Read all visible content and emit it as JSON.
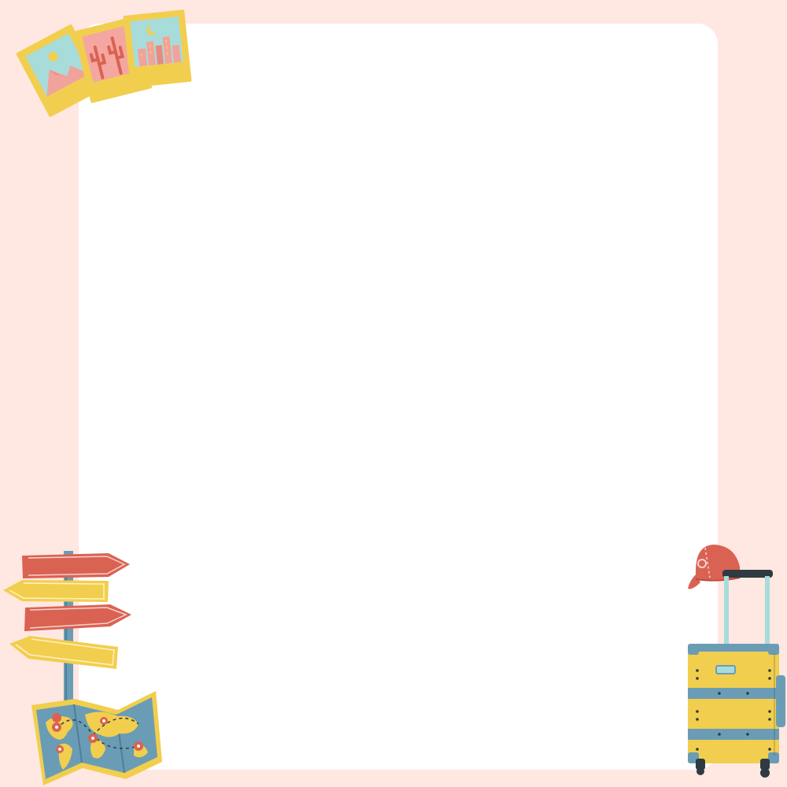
{
  "frame": {
    "background": "#FFE7E2",
    "panel": "#FFFFFF"
  },
  "colors": {
    "yellow": "#F2CE4E",
    "red": "#DA6253",
    "blue": "#6A9DB5",
    "sky": "#A8DCDA",
    "pink": "#F1A39B",
    "dark": "#2F3A42",
    "cream": "#FDF6E8"
  },
  "decorations": [
    {
      "name": "polaroid-mountain-icon",
      "kind": "photo"
    },
    {
      "name": "polaroid-cactus-icon",
      "kind": "photo"
    },
    {
      "name": "polaroid-city-icon",
      "kind": "photo"
    },
    {
      "name": "signpost-icon",
      "kind": "signpost"
    },
    {
      "name": "world-map-icon",
      "kind": "map"
    },
    {
      "name": "cap-icon",
      "kind": "cap"
    },
    {
      "name": "suitcase-icon",
      "kind": "suitcase"
    }
  ]
}
